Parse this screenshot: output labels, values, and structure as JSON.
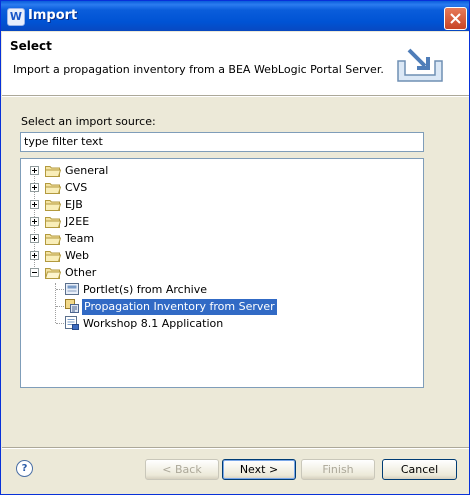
{
  "window": {
    "title": "Import",
    "app_icon_letter": "W"
  },
  "banner": {
    "title": "Select",
    "description": "Import a propagation inventory from a BEA WebLogic Portal Server."
  },
  "source": {
    "label": "Select an import source:",
    "filter_value": "type filter text"
  },
  "tree": {
    "folders": [
      {
        "label": "General",
        "expanded": false
      },
      {
        "label": "CVS",
        "expanded": false
      },
      {
        "label": "EJB",
        "expanded": false
      },
      {
        "label": "J2EE",
        "expanded": false
      },
      {
        "label": "Team",
        "expanded": false
      },
      {
        "label": "Web",
        "expanded": false
      },
      {
        "label": "Other",
        "expanded": true
      }
    ],
    "other_children": [
      {
        "label": "Portlet(s) from Archive",
        "icon": "archive-icon",
        "selected": false
      },
      {
        "label": "Propagation Inventory from Server",
        "icon": "server-inventory-icon",
        "selected": true
      },
      {
        "label": "Workshop 8.1 Application",
        "icon": "application-icon",
        "selected": false
      }
    ]
  },
  "buttons": {
    "help": "?",
    "back": "< Back",
    "next": "Next >",
    "finish": "Finish",
    "cancel": "Cancel"
  },
  "colors": {
    "selection": "#316ac5",
    "titlebar": "#0053d4"
  }
}
